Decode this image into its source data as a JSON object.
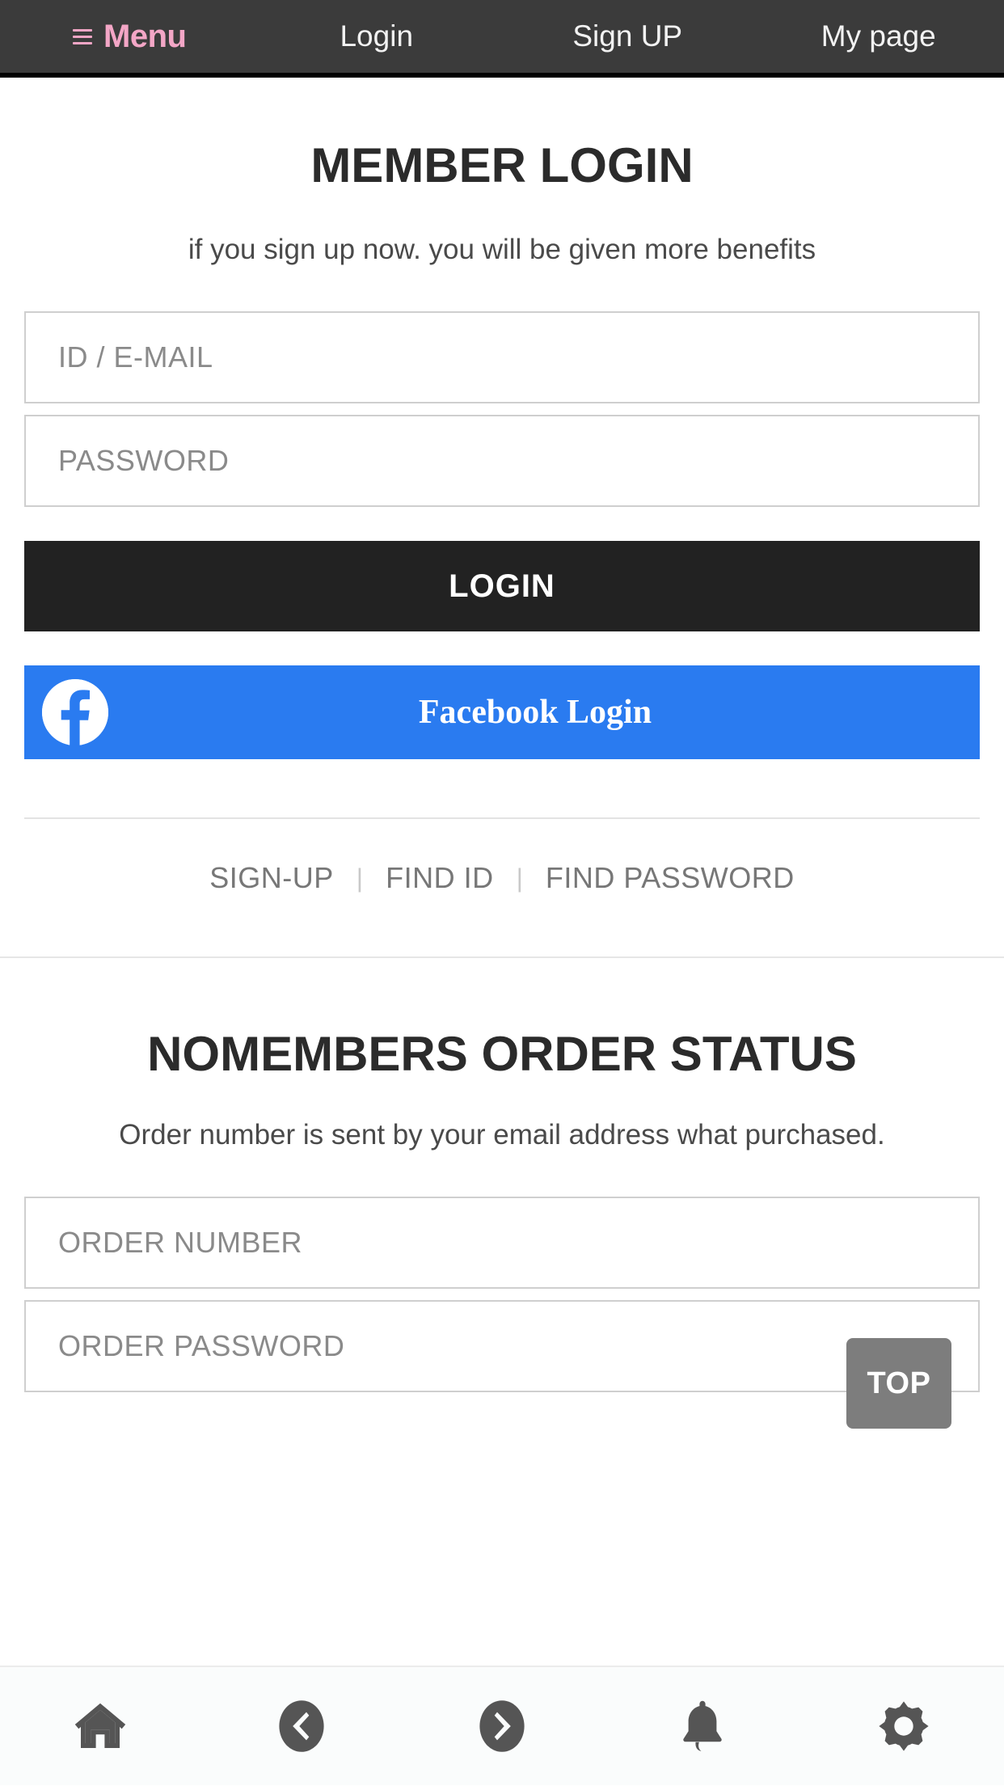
{
  "topnav": {
    "menu_icon": "hamburger-icon",
    "menu_label": "Menu",
    "menu_color": "#f3a6c6",
    "bar_color": "#3b3b3b",
    "items": [
      {
        "label": "Login"
      },
      {
        "label": "Sign UP"
      },
      {
        "label": "My page"
      }
    ]
  },
  "member_login": {
    "title": "MEMBER LOGIN",
    "subtitle": "if you sign up now. you will be given more benefits",
    "id_field": {
      "placeholder": "ID / E-MAIL",
      "value": ""
    },
    "password_field": {
      "placeholder": "PASSWORD",
      "value": ""
    },
    "login_button": {
      "label": "LOGIN",
      "color": "#222222"
    },
    "facebook_button": {
      "label": "Facebook Login",
      "color": "#2a7bf0",
      "icon": "facebook-icon"
    },
    "links": [
      {
        "label": "SIGN-UP"
      },
      {
        "label": "FIND ID"
      },
      {
        "label": "FIND PASSWORD"
      }
    ],
    "link_separator": "|"
  },
  "nomember_order": {
    "title": "NOMEMBERS ORDER STATUS",
    "subtitle": "Order number is sent by your email address what purchased.",
    "order_number_field": {
      "placeholder": "ORDER NUMBER",
      "value": ""
    },
    "order_password_field": {
      "placeholder": "ORDER PASSWORD",
      "value": ""
    }
  },
  "top_button": {
    "label": "TOP",
    "color": "#7d7d7d"
  },
  "bottomnav": {
    "icon_color": "#555555",
    "items": [
      {
        "icon": "home-icon"
      },
      {
        "icon": "back-circle-icon"
      },
      {
        "icon": "forward-circle-icon"
      },
      {
        "icon": "bell-icon"
      },
      {
        "icon": "gear-icon"
      }
    ]
  }
}
